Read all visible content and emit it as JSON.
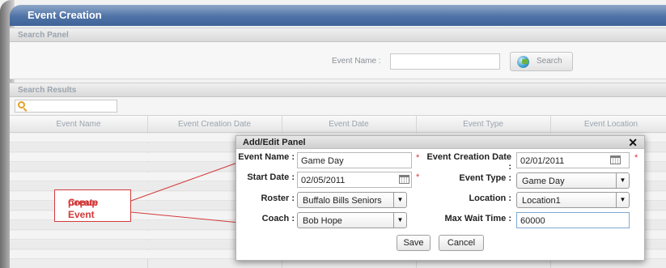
{
  "window": {
    "title": "Event Creation"
  },
  "search_panel": {
    "title": "Search Panel",
    "event_name_label": "Event Name :",
    "event_name_value": "",
    "search_button_label": "Search"
  },
  "search_results": {
    "title": "Search Results",
    "filter_value": "",
    "columns": [
      "Event Name",
      "Event Creation Date",
      "Event Date",
      "Event Type",
      "Event Location"
    ]
  },
  "annotation": {
    "line1": "Create Event",
    "line2": "popup",
    "color": "#d23a3a"
  },
  "popup": {
    "title": "Add/Edit Panel",
    "close_glyph": "✕",
    "fields": {
      "event_name": {
        "label": "Event Name :",
        "value": "Game Day"
      },
      "event_creation_date": {
        "label": "Event Creation Date :",
        "value": "02/01/2011"
      },
      "start_date": {
        "label": "Start Date :",
        "value": "02/05/2011"
      },
      "event_type": {
        "label": "Event Type :",
        "value": "Game Day"
      },
      "roster": {
        "label": "Roster :",
        "value": "Buffalo Bills Seniors"
      },
      "location": {
        "label": "Location :",
        "value": "Location1"
      },
      "coach": {
        "label": "Coach :",
        "value": "Bob Hope"
      },
      "max_wait_time": {
        "label": "Max Wait Time :",
        "value": "60000"
      }
    },
    "required_mark": "*",
    "caret_glyph": "▼",
    "save_label": "Save",
    "cancel_label": "Cancel"
  },
  "colors": {
    "title_bar": "#4f73a6",
    "required": "#d23a3a",
    "focus_border": "#7fa8d6"
  }
}
